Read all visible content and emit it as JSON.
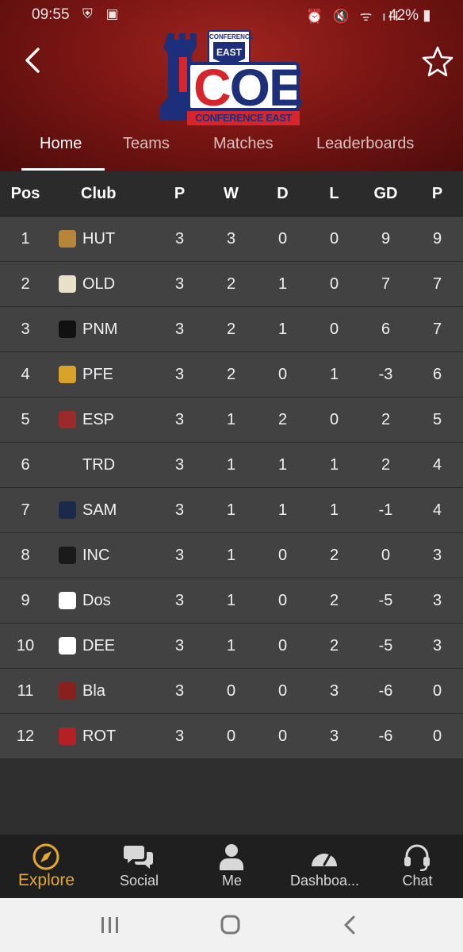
{
  "status": {
    "time": "09:55",
    "battery": "42%"
  },
  "tabs": [
    "Home",
    "Teams",
    "Matches",
    "Leaderboards"
  ],
  "table": {
    "headers": [
      "Pos",
      "Club",
      "P",
      "W",
      "D",
      "L",
      "GD",
      "P"
    ],
    "rows": [
      {
        "pos": "1",
        "club": "HUT",
        "p": "3",
        "w": "3",
        "d": "0",
        "l": "0",
        "gd": "9",
        "pts": "9",
        "crest": "#b8863b"
      },
      {
        "pos": "2",
        "club": "OLD",
        "p": "3",
        "w": "2",
        "d": "1",
        "l": "0",
        "gd": "7",
        "pts": "7",
        "crest": "#e8e0c8"
      },
      {
        "pos": "3",
        "club": "PNM",
        "p": "3",
        "w": "2",
        "d": "1",
        "l": "0",
        "gd": "6",
        "pts": "7",
        "crest": "#111111"
      },
      {
        "pos": "4",
        "club": "PFE",
        "p": "3",
        "w": "2",
        "d": "0",
        "l": "1",
        "gd": "-3",
        "pts": "6",
        "crest": "#d9a22b"
      },
      {
        "pos": "5",
        "club": "ESP",
        "p": "3",
        "w": "1",
        "d": "2",
        "l": "0",
        "gd": "2",
        "pts": "5",
        "crest": "#9c2a2a"
      },
      {
        "pos": "6",
        "club": "TRD",
        "p": "3",
        "w": "1",
        "d": "1",
        "l": "1",
        "gd": "2",
        "pts": "4",
        "crest": "#424242"
      },
      {
        "pos": "7",
        "club": "SAM",
        "p": "3",
        "w": "1",
        "d": "1",
        "l": "1",
        "gd": "-1",
        "pts": "4",
        "crest": "#1b2a4a"
      },
      {
        "pos": "8",
        "club": "INC",
        "p": "3",
        "w": "1",
        "d": "0",
        "l": "2",
        "gd": "0",
        "pts": "3",
        "crest": "#1a1a1a"
      },
      {
        "pos": "9",
        "club": "Dos",
        "p": "3",
        "w": "1",
        "d": "0",
        "l": "2",
        "gd": "-5",
        "pts": "3",
        "crest": "#ffffff"
      },
      {
        "pos": "10",
        "club": "DEE",
        "p": "3",
        "w": "1",
        "d": "0",
        "l": "2",
        "gd": "-5",
        "pts": "3",
        "crest": "#ffffff"
      },
      {
        "pos": "11",
        "club": "Bla",
        "p": "3",
        "w": "0",
        "d": "0",
        "l": "3",
        "gd": "-6",
        "pts": "0",
        "crest": "#8a1f1f"
      },
      {
        "pos": "12",
        "club": "ROT",
        "p": "3",
        "w": "0",
        "d": "0",
        "l": "3",
        "gd": "-6",
        "pts": "0",
        "crest": "#b52027"
      }
    ]
  },
  "nav": [
    {
      "label": "Explore",
      "icon": "compass-icon"
    },
    {
      "label": "Social",
      "icon": "chat-bubbles-icon"
    },
    {
      "label": "Me",
      "icon": "person-icon"
    },
    {
      "label": "Dashboa...",
      "icon": "gauge-icon"
    },
    {
      "label": "Chat",
      "icon": "headset-icon"
    }
  ],
  "colors": {
    "accent": "#e7a82e",
    "header": "#7c1614",
    "row": "#424242"
  }
}
